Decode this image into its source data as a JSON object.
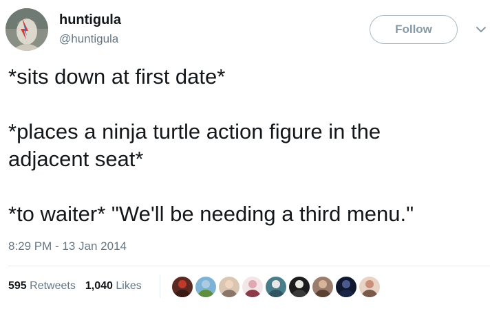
{
  "user": {
    "display_name": "huntigula",
    "handle": "@huntigula"
  },
  "header": {
    "follow_label": "Follow",
    "caret_icon": "chevron-down-icon"
  },
  "tweet": {
    "lines": [
      "*sits down at first date*",
      "",
      "*places a ninja turtle action figure in the",
      "adjacent seat*",
      "",
      "*to waiter* \"We'll be needing a third menu.\""
    ],
    "timestamp": "8:29 PM - 13 Jan 2014"
  },
  "stats": {
    "retweets_count": "595",
    "retweets_label": "Retweets",
    "likes_count": "1,040",
    "likes_label": "Likes"
  },
  "likers": [
    {
      "bg": "#5a2a22",
      "head": "#c0392b",
      "body": "#3b1a14"
    },
    {
      "bg": "#7fb3d5",
      "head": "#a9cce3",
      "body": "#5d8f3e"
    },
    {
      "bg": "#d9c7b3",
      "head": "#f0d5c0",
      "body": "#8a7566"
    },
    {
      "bg": "#f3e6e8",
      "head": "#e0a9b0",
      "body": "#8b3a4a"
    },
    {
      "bg": "#4a7d8a",
      "head": "#e8e8e8",
      "body": "#2f5560"
    },
    {
      "bg": "#1c1c1c",
      "head": "#e8e8e0",
      "body": "#3a3a3a"
    },
    {
      "bg": "#9b7d6e",
      "head": "#d8b49a",
      "body": "#5c4030"
    },
    {
      "bg": "#101830",
      "head": "#4a5a8a",
      "body": "#1a2545"
    },
    {
      "bg": "#e8d4c4",
      "head": "#c98f7a",
      "body": "#7a5a4a"
    }
  ],
  "colors": {
    "text": "#14171a",
    "secondary": "#657786",
    "divider": "#e6ecf0",
    "follow_border": "#aab8c2"
  }
}
